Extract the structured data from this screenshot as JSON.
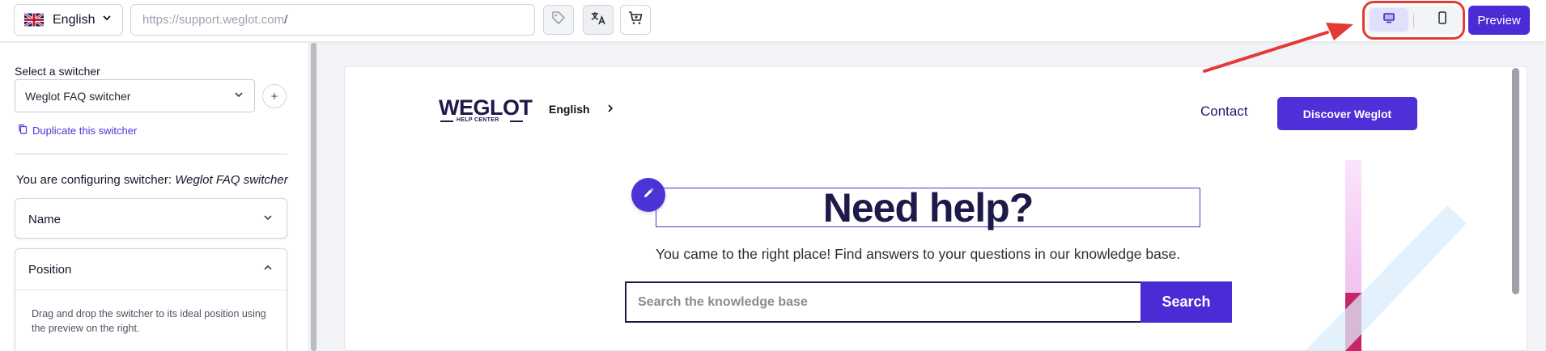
{
  "toolbar": {
    "language": "English",
    "url_host": "https://support.weglot.com",
    "url_path": "/",
    "preview_label": "Preview",
    "icons": [
      "uk-flag-icon",
      "chevron-down-icon",
      "tag-icon",
      "translate-icon",
      "cart-icon",
      "desktop-icon",
      "mobile-icon"
    ]
  },
  "sidebar": {
    "select_label": "Select a switcher",
    "switcher_value": "Weglot FAQ switcher",
    "add_symbol": "+",
    "duplicate_label": "Duplicate this switcher",
    "config_prefix": "You are configuring switcher:",
    "config_name": "Weglot FAQ switcher",
    "accordion_name": "Name",
    "accordion_position": "Position",
    "position_help": "Drag and drop the switcher to its ideal position using the preview on the right."
  },
  "site": {
    "logo_word": "WEGLOT",
    "logo_sub": "HELP CENTER",
    "language": "English",
    "contact": "Contact",
    "discover": "Discover Weglot",
    "hero_title": "Need help?",
    "hero_subtitle": "You came to the right place! Find answers to your questions in our knowledge base.",
    "search_placeholder": "Search the knowledge base",
    "search_button": "Search"
  },
  "colors": {
    "accent": "#4b2bd6",
    "brand_dark": "#1d1a4a",
    "annotation_red": "#e53935"
  }
}
